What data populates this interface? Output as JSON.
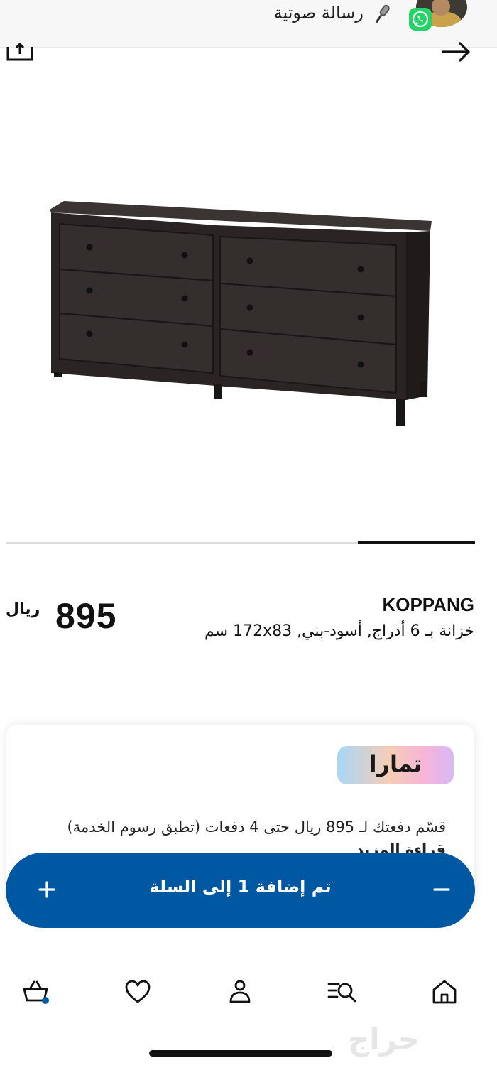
{
  "whatsapp_banner": {
    "label": "رسالة صوتية",
    "icons": [
      "whatsapp-icon",
      "microphone-icon",
      "avatar"
    ]
  },
  "header": {
    "icons": [
      "share-icon",
      "forward-arrow-icon"
    ]
  },
  "carousel": {
    "position_percent": 75
  },
  "product": {
    "name": "KOPPANG",
    "description": "خزانة بـ 6 أدراج, أسود-بني, 172x83 سم",
    "price": "895",
    "currency": "ريال"
  },
  "tamara": {
    "badge": "تمارا",
    "text": "قسّم دفعتك لـ 895 ريال حتى 4 دفعات (تطبق رسوم الخدمة)",
    "link": "قراءة المزيد"
  },
  "cart": {
    "label": "تم إضافة 1 إلى السلة",
    "plus": "+",
    "minus": "−",
    "brand_color": "#0058a3"
  },
  "nav": {
    "items": [
      "basket-icon",
      "heart-icon",
      "person-icon",
      "search-list-icon",
      "home-icon"
    ],
    "basket_dot_color": "#0058a3"
  },
  "watermark": "حراج"
}
